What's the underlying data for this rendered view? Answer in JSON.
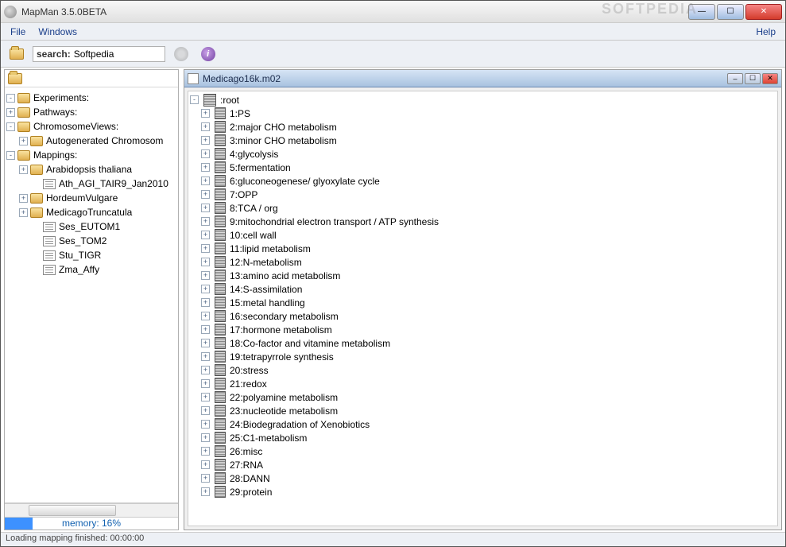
{
  "window": {
    "title": "MapMan 3.5.0BETA"
  },
  "menubar": {
    "file": "File",
    "windows": "Windows",
    "help": "Help"
  },
  "toolbar": {
    "search_label": "search:",
    "search_value": "Softpedia"
  },
  "sidebar": {
    "tree": [
      {
        "level": 0,
        "exp": "-",
        "icon": "folder",
        "label": "Experiments:"
      },
      {
        "level": 0,
        "exp": "+",
        "icon": "folder",
        "label": "Pathways:"
      },
      {
        "level": 0,
        "exp": "-",
        "icon": "folder",
        "label": "ChromosomeViews:"
      },
      {
        "level": 1,
        "exp": "+",
        "icon": "folder",
        "label": "Autogenerated Chromosom"
      },
      {
        "level": 0,
        "exp": "-",
        "icon": "folder",
        "label": "Mappings:"
      },
      {
        "level": 1,
        "exp": "+",
        "icon": "folder",
        "label": "Arabidopsis thaliana"
      },
      {
        "level": 2,
        "exp": " ",
        "icon": "doc",
        "label": "Ath_AGI_TAIR9_Jan2010"
      },
      {
        "level": 1,
        "exp": "+",
        "icon": "folder",
        "label": "HordeumVulgare"
      },
      {
        "level": 1,
        "exp": "+",
        "icon": "folder",
        "label": "MedicagoTruncatula"
      },
      {
        "level": 2,
        "exp": " ",
        "icon": "doc",
        "label": "Ses_EUTOM1"
      },
      {
        "level": 2,
        "exp": " ",
        "icon": "doc",
        "label": "Ses_TOM2"
      },
      {
        "level": 2,
        "exp": " ",
        "icon": "doc",
        "label": "Stu_TIGR"
      },
      {
        "level": 2,
        "exp": " ",
        "icon": "doc",
        "label": "Zma_Affy"
      }
    ],
    "memory_label": "memory: 16%",
    "memory_pct": 16
  },
  "panel": {
    "title": "Medicago16k.m02",
    "root_label": ":root",
    "items": [
      "1:PS",
      "2:major CHO metabolism",
      "3:minor CHO metabolism",
      "4:glycolysis",
      "5:fermentation",
      "6:gluconeogenese/ glyoxylate cycle",
      "7:OPP",
      "8:TCA / org",
      "9:mitochondrial electron transport / ATP synthesis",
      "10:cell wall",
      "11:lipid metabolism",
      "12:N-metabolism",
      "13:amino acid metabolism",
      "14:S-assimilation",
      "15:metal handling",
      "16:secondary metabolism",
      "17:hormone metabolism",
      "18:Co-factor and vitamine metabolism",
      "19:tetrapyrrole synthesis",
      "20:stress",
      "21:redox",
      "22:polyamine metabolism",
      "23:nucleotide metabolism",
      "24:Biodegradation of Xenobiotics",
      "25:C1-metabolism",
      "26:misc",
      "27:RNA",
      "28:DANN",
      "29:protein"
    ]
  },
  "statusbar": {
    "text": "Loading mapping finished: 00:00:00"
  },
  "watermark": "SOFTPEDIA"
}
